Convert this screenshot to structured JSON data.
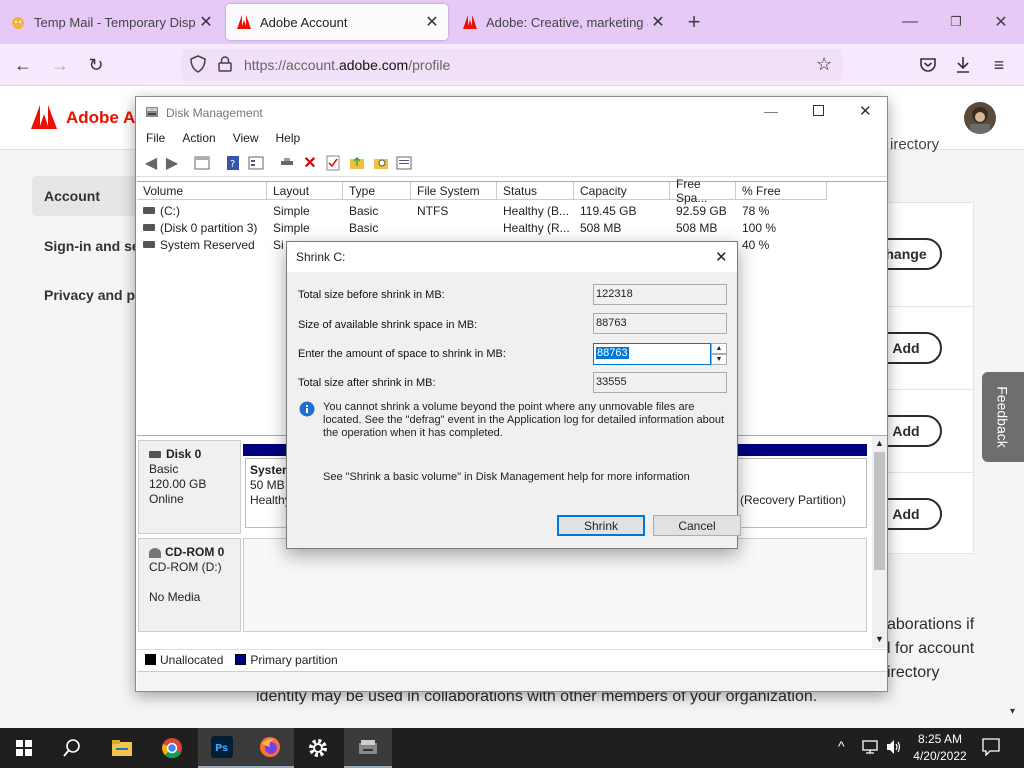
{
  "browser": {
    "tabs": [
      {
        "title": "Temp Mail - Temporary Dispos"
      },
      {
        "title": "Adobe Account"
      },
      {
        "title": "Adobe: Creative, marketing and"
      }
    ],
    "url_prefix": "https://account.",
    "url_domain": "adobe.com",
    "url_path": "/profile"
  },
  "adobe": {
    "brand": "Adobe Ac",
    "sidebar": [
      "Account",
      "Sign-in and secu",
      "Privacy and per"
    ],
    "buttons": {
      "change": "hange",
      "add1": "Add",
      "add2": "Add",
      "add3": "Add"
    },
    "fragment_top": "irectory",
    "text_lines": [
      "aborations if",
      "l for account",
      "irectory"
    ],
    "bottom_line": "identity may be used in collaborations with other members of your organization.",
    "feedback": "Feedback"
  },
  "disk_management": {
    "title": "Disk Management",
    "menu": [
      "File",
      "Action",
      "View",
      "Help"
    ],
    "columns": [
      "Volume",
      "Layout",
      "Type",
      "File System",
      "Status",
      "Capacity",
      "Free Spa...",
      "% Free"
    ],
    "rows": [
      [
        "(C:)",
        "Simple",
        "Basic",
        "NTFS",
        "Healthy (B...",
        "119.45 GB",
        "92.59 GB",
        "78 %"
      ],
      [
        "(Disk 0 partition 3)",
        "Simple",
        "Basic",
        "",
        "Healthy (R...",
        "508 MB",
        "508 MB",
        "100 %"
      ],
      [
        "System Reserved",
        "Si",
        "",
        "",
        "",
        "",
        "",
        "40 %"
      ]
    ],
    "disk0": {
      "name": "Disk 0",
      "type": "Basic",
      "size": "120.00 GB",
      "state": "Online"
    },
    "partition_sys": {
      "name": "System",
      "size": "50 MB",
      "status": "Healthy"
    },
    "partition_recovery": "(Recovery Partition)",
    "cdrom": {
      "name": "CD-ROM 0",
      "drive": "CD-ROM (D:)",
      "state": "No Media"
    },
    "legend": [
      "Unallocated",
      "Primary partition"
    ]
  },
  "shrink_dialog": {
    "title": "Shrink C:",
    "label_total_before": "Total size before shrink in MB:",
    "value_total_before": "122318",
    "label_available": "Size of available shrink space in MB:",
    "value_available": "88763",
    "label_amount": "Enter the amount of space to shrink in MB:",
    "value_amount": "88763",
    "label_total_after": "Total size after shrink in MB:",
    "value_total_after": "33555",
    "info_text": "You cannot shrink a volume beyond the point where any unmovable files are located. See the \"defrag\" event in the Application log for detailed information about the operation when it has completed.",
    "help_text": "See \"Shrink a basic volume\" in Disk Management help for more information",
    "shrink_button": "Shrink",
    "cancel_button": "Cancel"
  },
  "taskbar": {
    "time": "8:25 AM",
    "date": "4/20/2022"
  },
  "colors": {
    "tabbar": "#e7c9f7",
    "adobe_red": "#eb1000",
    "primary_partition": "#000080",
    "accent": "#0078d7"
  }
}
